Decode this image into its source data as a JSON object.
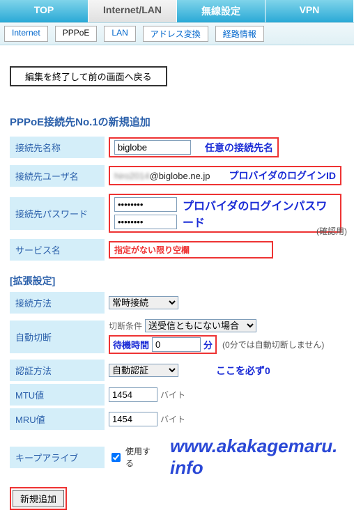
{
  "mainTabs": {
    "top": "TOP",
    "internetLan": "Internet/LAN",
    "wireless": "無線設定",
    "vpn": "VPN"
  },
  "subTabs": {
    "internet": "Internet",
    "pppoe": "PPPoE",
    "lan": "LAN",
    "addrTrans": "アドレス変換",
    "routeInfo": "経路情報"
  },
  "backBtn": "編集を終了して前の画面へ戻る",
  "sectionTitle": "PPPoE接続先No.1の新規追加",
  "labels": {
    "connName": "接続先名称",
    "connUser": "接続先ユーザ名",
    "connPass": "接続先パスワード",
    "serviceName": "サービス名",
    "connMethod": "接続方法",
    "autoDisc": "自動切断",
    "authMethod": "認証方法",
    "mtu": "MTU値",
    "mru": "MRU値",
    "keepalive": "キープアライブ"
  },
  "values": {
    "connName": "biglobe",
    "connUserSuffix": "@biglobe.ne.jp",
    "pass": "●●●●●●●●",
    "connMethod": "常時接続",
    "discCond": "送受信ともにない場合",
    "waitTime": "0",
    "authMethod": "自動認証",
    "mtu": "1454",
    "mru": "1454",
    "keepalive": true
  },
  "ann": {
    "connName": "任意の接続先名",
    "connUser": "プロバイダのログインID",
    "connPass": "プロバイダのログインパスワード",
    "serviceName": "指定がない限り空欄",
    "waitLabel": "待機時間",
    "waitUnit": "分",
    "waitNote": "(0分では自動切断しません)",
    "authNote": "ここを必ず0",
    "confirmNote": "(確認用)"
  },
  "text": {
    "discCondLabel": "切断条件",
    "use": "使用する",
    "byte": "バイト",
    "extTitle": "[拡張設定]"
  },
  "submit": "新規追加",
  "watermark": "www.akakagemaru. info"
}
